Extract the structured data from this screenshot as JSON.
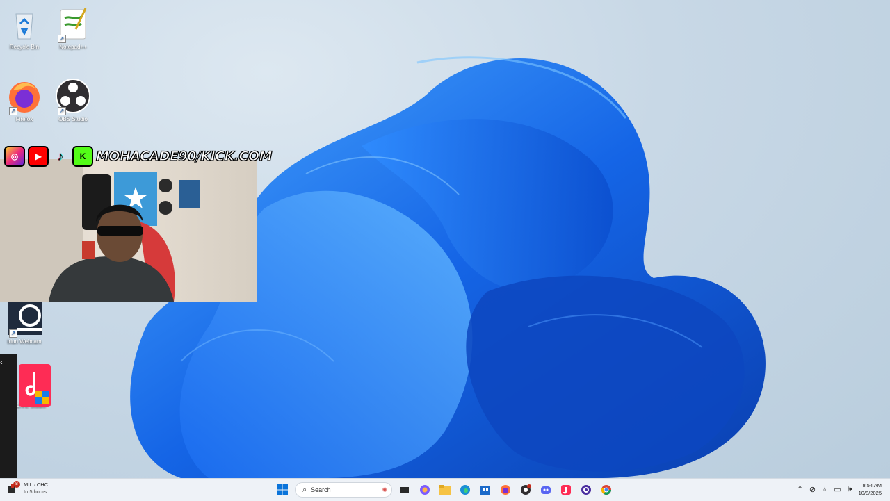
{
  "desktop": {
    "icons": [
      {
        "label": "Recycle Bin",
        "icon": "recycle-bin-icon"
      },
      {
        "label": "Notepad++",
        "icon": "notepad-plus-plus-icon"
      },
      {
        "label": "Firefox",
        "icon": "firefox-icon"
      },
      {
        "label": "OBS Studio",
        "icon": "obs-studio-icon"
      },
      {
        "label": "Iriun Webcam",
        "icon": "iriun-webcam-icon"
      },
      {
        "label": "LIVE Studio",
        "icon": "tiktok-live-studio-icon"
      }
    ]
  },
  "overlay": {
    "handle": "MOHACADE90/KICK.COM",
    "socials": [
      "instagram-icon",
      "youtube-icon",
      "tiktok-icon",
      "kick-icon"
    ]
  },
  "edge_panel": {
    "glyph": "‹"
  },
  "taskbar": {
    "weather": {
      "badge": "8",
      "line1": "MIL · CHC",
      "line2": "In 5 hours"
    },
    "search_placeholder": "Search",
    "pinned": [
      "windows-start-icon",
      "copilot-icon",
      "task-view-icon",
      "color-app-icon",
      "file-explorer-icon",
      "edge-icon",
      "microsoft-store-icon",
      "firefox-icon",
      "obs-studio-icon",
      "discord-icon",
      "tiktok-live-icon",
      "obs-icon-2",
      "chrome-icon"
    ],
    "clock": {
      "time": "8:54 AM",
      "date": "10/8/2025"
    }
  }
}
